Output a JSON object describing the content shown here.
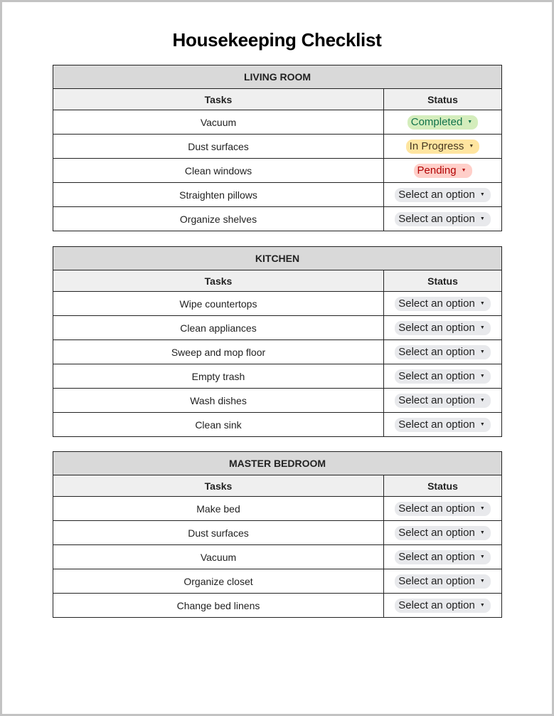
{
  "title": "Housekeeping Checklist",
  "columns": {
    "task": "Tasks",
    "status": "Status"
  },
  "caret_icon": "▼",
  "status_styles": {
    "Completed": "completed",
    "In Progress": "in-progress",
    "Pending": "pending",
    "Select an option": "default"
  },
  "status_colors": {
    "completed_bg": "#d4edbc",
    "completed_fg": "#11734b",
    "in_progress_bg": "#ffe5a0",
    "in_progress_fg": "#473821",
    "pending_bg": "#ffcfc9",
    "pending_fg": "#b10202",
    "default_bg": "#e8e9ec",
    "default_fg": "#222222"
  },
  "sections": [
    {
      "name": "LIVING ROOM",
      "rows": [
        {
          "task": "Vacuum",
          "status": "Completed"
        },
        {
          "task": "Dust surfaces",
          "status": "In Progress"
        },
        {
          "task": "Clean windows",
          "status": "Pending"
        },
        {
          "task": "Straighten pillows",
          "status": "Select an option"
        },
        {
          "task": "Organize shelves",
          "status": "Select an option"
        }
      ]
    },
    {
      "name": "KITCHEN",
      "rows": [
        {
          "task": "Wipe countertops",
          "status": "Select an option"
        },
        {
          "task": "Clean appliances",
          "status": "Select an option"
        },
        {
          "task": "Sweep and mop floor",
          "status": "Select an option"
        },
        {
          "task": "Empty trash",
          "status": "Select an option"
        },
        {
          "task": "Wash dishes",
          "status": "Select an option"
        },
        {
          "task": "Clean sink",
          "status": "Select an option"
        }
      ]
    },
    {
      "name": "MASTER BEDROOM",
      "rows": [
        {
          "task": "Make bed",
          "status": "Select an option"
        },
        {
          "task": "Dust surfaces",
          "status": "Select an option"
        },
        {
          "task": "Vacuum",
          "status": "Select an option"
        },
        {
          "task": "Organize closet",
          "status": "Select an option"
        },
        {
          "task": "Change bed linens",
          "status": "Select an option"
        }
      ]
    }
  ]
}
